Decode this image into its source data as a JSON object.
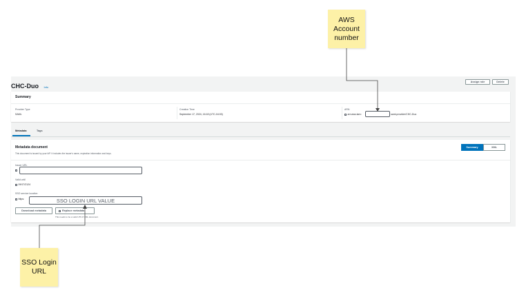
{
  "header": {
    "title": "CHC-Duo",
    "info_link": "Info",
    "assign_role_label": "Assign role",
    "delete_label": "Delete"
  },
  "summary": {
    "title": "Summary",
    "provider_type_label": "Provider Type",
    "provider_type_value": "SAML",
    "creation_time_label": "Creation Time",
    "creation_time_value": "September 17, 2024, 16:18 (UTC-04:00)",
    "arn_label": "ARN",
    "arn_prefix": "arn:aws:iam::",
    "arn_suffix": "saml-provider/CHC-Duo"
  },
  "tabs": [
    {
      "label": "Metadata",
      "active": true
    },
    {
      "label": "Tags",
      "active": false
    }
  ],
  "metadata": {
    "title": "Metadata document",
    "description": "This document is issued by your IdP. It includes the issuer's name, expiration information and keys.",
    "view_toggle": [
      "Summary",
      "XML"
    ],
    "issuer_url_label": "Issuer URL",
    "valid_until_label": "Valid until",
    "valid_until_value": "09/17/2124",
    "sso_location_label": "SSO service location",
    "sso_prefix": "https:",
    "sso_redacted_text": "SSO LOGIN URL VALUE",
    "download_label": "Download metadata",
    "replace_label": "Replace metadata",
    "helper_text": "This needs to be a valid UTF-8 XML document."
  },
  "annotations": {
    "aws_account_note": [
      "AWS",
      "Account",
      "number"
    ],
    "sso_login_note": [
      "SSO Login",
      "URL"
    ]
  },
  "colors": {
    "accent": "#0073bb",
    "sticky": "#fdf1a7",
    "panel": "#f2f3f3"
  }
}
